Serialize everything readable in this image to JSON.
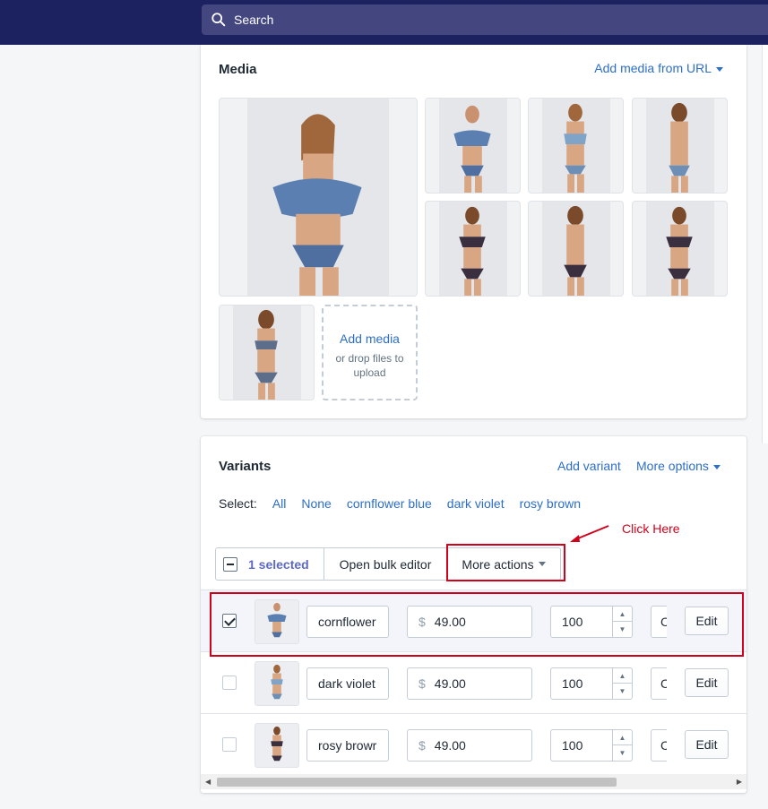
{
  "search": {
    "label": "Search"
  },
  "media": {
    "title": "Media",
    "add_from_url": "Add media from URL",
    "add_media": "Add media",
    "drop_hint": "or drop files to upload"
  },
  "variants": {
    "title": "Variants",
    "add_variant": "Add variant",
    "more_options": "More options",
    "select_label": "Select:",
    "select_options": [
      "All",
      "None",
      "cornflower blue",
      "dark violet",
      "rosy brown"
    ],
    "bulk": {
      "selected": "1 selected",
      "open_bulk_editor": "Open bulk editor",
      "more_actions": "More actions"
    },
    "annotation": "Click Here",
    "currency": "$",
    "edit_label": "Edit",
    "rows": [
      {
        "name": "cornflower",
        "price": "49.00",
        "qty": "100",
        "sku": "C",
        "checked": true
      },
      {
        "name": "dark violet",
        "price": "49.00",
        "qty": "100",
        "sku": "C",
        "checked": false
      },
      {
        "name": "rosy browr",
        "price": "49.00",
        "qty": "100",
        "sku": "C",
        "checked": false
      }
    ]
  },
  "colors": {
    "topbar": "#1c2260",
    "link": "#2c6ecb",
    "annotation_red": "#d0021b",
    "selected_text": "#5c6ac4"
  }
}
